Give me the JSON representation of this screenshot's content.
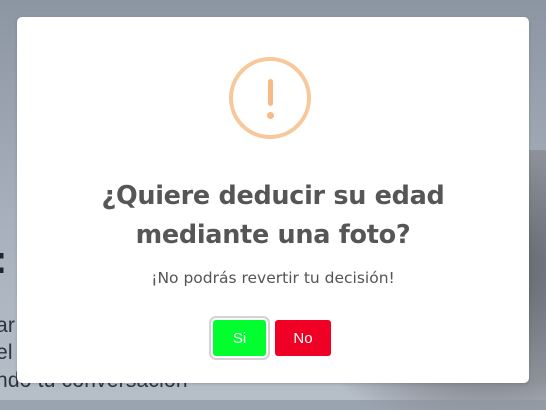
{
  "background": {
    "text_lines": [
      "ar",
      "el",
      "ndo tu conversación"
    ]
  },
  "dialog": {
    "icon": "exclamation-icon",
    "title_line1": "¿Quiere deducir su edad",
    "title_line2": "mediante una foto?",
    "message": "¡No podrás revertir tu decisión!",
    "confirm_label": "Si",
    "cancel_label": "No",
    "colors": {
      "icon": "#f8bb86",
      "confirm": "#00ff2e",
      "cancel": "#f00024"
    }
  }
}
